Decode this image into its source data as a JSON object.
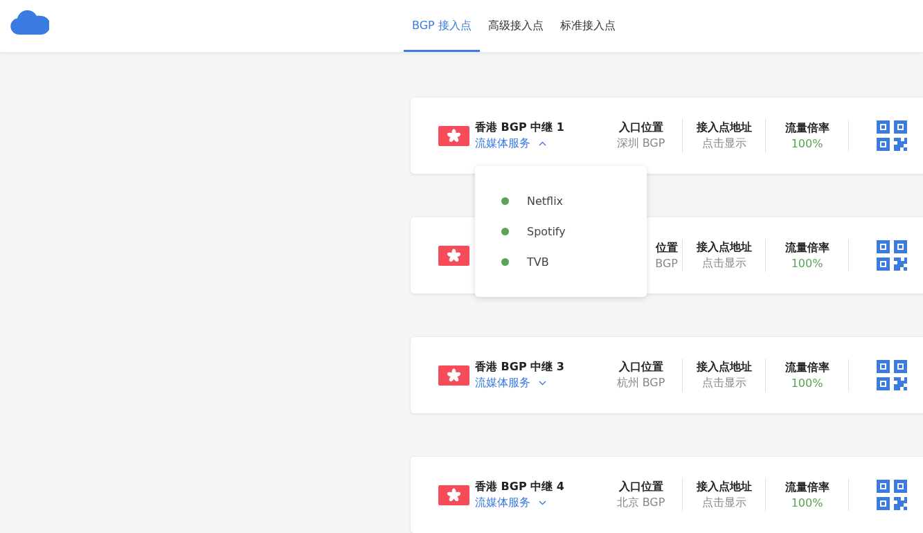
{
  "tabs": [
    {
      "label": "BGP 接入点",
      "selected": true
    },
    {
      "label": "高级接入点",
      "selected": false
    },
    {
      "label": "标准接入点",
      "selected": false
    }
  ],
  "cards": [
    {
      "name": "香港 BGP 中继 1",
      "service": {
        "label": "流媒体服务",
        "expanded": true,
        "items": [
          {
            "label": "Netflix",
            "color": "#5aa454"
          },
          {
            "label": "Spotify",
            "color": "#5aa454"
          },
          {
            "label": "TVB",
            "color": "#5aa454"
          }
        ]
      },
      "stats": [
        {
          "kind": "location",
          "label": "入口位置",
          "value": "深圳 BGP"
        },
        {
          "kind": "address",
          "label": "接入点地址",
          "value": "点击显示"
        },
        {
          "kind": "rate",
          "label": "流量倍率",
          "value": "100%"
        }
      ]
    },
    {
      "stats": [
        {
          "kind": "location",
          "label": "位置",
          "value": "BGP"
        },
        {
          "kind": "address",
          "label": "接入点地址",
          "value": "点击显示"
        },
        {
          "kind": "rate",
          "label": "流量倍率",
          "value": "100%"
        }
      ]
    },
    {
      "name": "香港 BGP 中继 3",
      "service": {
        "label": "流媒体服务",
        "expanded": false
      },
      "stats": [
        {
          "kind": "location",
          "label": "入口位置",
          "value": "杭州 BGP"
        },
        {
          "kind": "address",
          "label": "接入点地址",
          "value": "点击显示"
        },
        {
          "kind": "rate",
          "label": "流量倍率",
          "value": "100%"
        }
      ]
    },
    {
      "name": "香港 BGP 中继 4",
      "service": {
        "label": "流媒体服务",
        "expanded": false
      },
      "stats": [
        {
          "kind": "location",
          "label": "入口位置",
          "value": "北京 BGP"
        },
        {
          "kind": "address",
          "label": "接入点地址",
          "value": "点击显示"
        },
        {
          "kind": "rate",
          "label": "流量倍率",
          "value": "100%"
        }
      ]
    }
  ]
}
